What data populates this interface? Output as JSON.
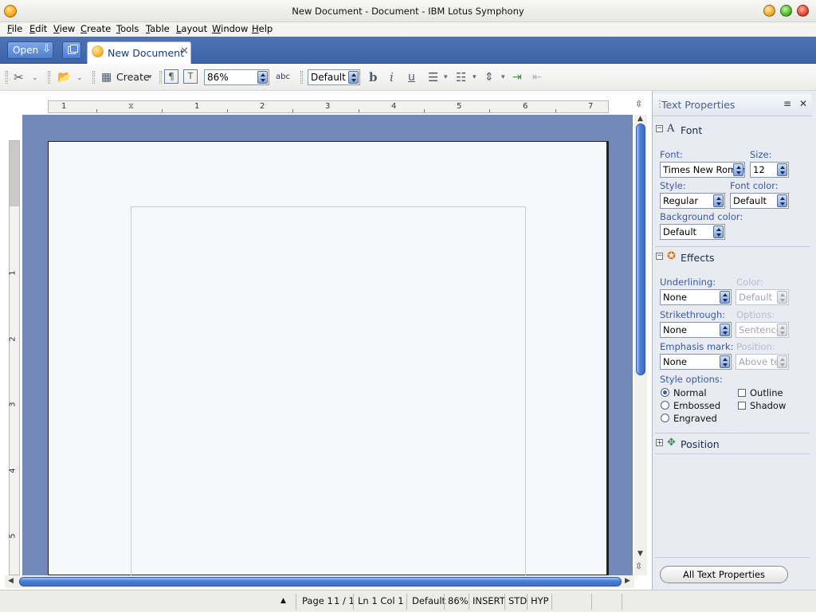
{
  "window": {
    "title": "New Document - Document - IBM Lotus Symphony"
  },
  "menu": [
    {
      "first": "F",
      "rest": "ile"
    },
    {
      "first": "E",
      "rest": "dit"
    },
    {
      "first": "V",
      "rest": "iew"
    },
    {
      "first": "C",
      "rest": "reate"
    },
    {
      "first": "T",
      "rest": "ools"
    },
    {
      "first": "T",
      "rest": "able"
    },
    {
      "first": "L",
      "rest": "ayout"
    },
    {
      "first": "W",
      "rest": "indow"
    },
    {
      "first": "H",
      "rest": "elp"
    }
  ],
  "tabbar": {
    "open_label": "Open",
    "doc_tab_label": "New Document"
  },
  "toolbar": {
    "create_label": "Create",
    "zoom_value": "86%",
    "style_value": "Default T",
    "bold_glyph": "b",
    "italic_glyph": "i",
    "underline_glyph": "u",
    "pilcrow_glyph": "¶",
    "spell_glyph": "abc"
  },
  "ruler": {
    "h_ticks": [
      "1",
      "1",
      "2",
      "3",
      "4",
      "5",
      "6",
      "7"
    ],
    "v_ticks": [
      "1",
      "2",
      "3",
      "4",
      "5"
    ]
  },
  "status": {
    "page": "Page  1",
    "pages": "1 / 1",
    "position": "Ln 1 Col 1",
    "style": "Default",
    "zoom": "86%",
    "mode": "INSERT",
    "selection": "STD",
    "hyphen": "HYP"
  },
  "panel": {
    "title": "Text Properties",
    "font_section": {
      "label": "Font",
      "font_label": "Font:",
      "font_value": "Times New Roman",
      "size_label": "Size:",
      "size_value": "12",
      "style_label": "Style:",
      "style_value": "Regular",
      "color_label": "Font color:",
      "color_value": "Default",
      "bg_label": "Background color:",
      "bg_value": "Default"
    },
    "effects_section": {
      "label": "Effects",
      "underlining_label": "Underlining:",
      "underlining_value": "None",
      "ucolor_label": "Color:",
      "ucolor_value": "Default",
      "strike_label": "Strikethrough:",
      "strike_value": "None",
      "options_label": "Options:",
      "options_value": "Sentence",
      "emphasis_label": "Emphasis mark:",
      "emphasis_value": "None",
      "position_label": "Position:",
      "position_value": "Above tex",
      "style_options_label": "Style options:",
      "radios": [
        {
          "label": "Normal",
          "checked": true
        },
        {
          "label": "Embossed",
          "checked": false
        },
        {
          "label": "Engraved",
          "checked": false
        }
      ],
      "checks": [
        {
          "label": "Outline",
          "checked": false
        },
        {
          "label": "Shadow",
          "checked": false
        }
      ]
    },
    "position_section": {
      "label": "Position"
    },
    "all_props_label": "All Text Properties"
  }
}
